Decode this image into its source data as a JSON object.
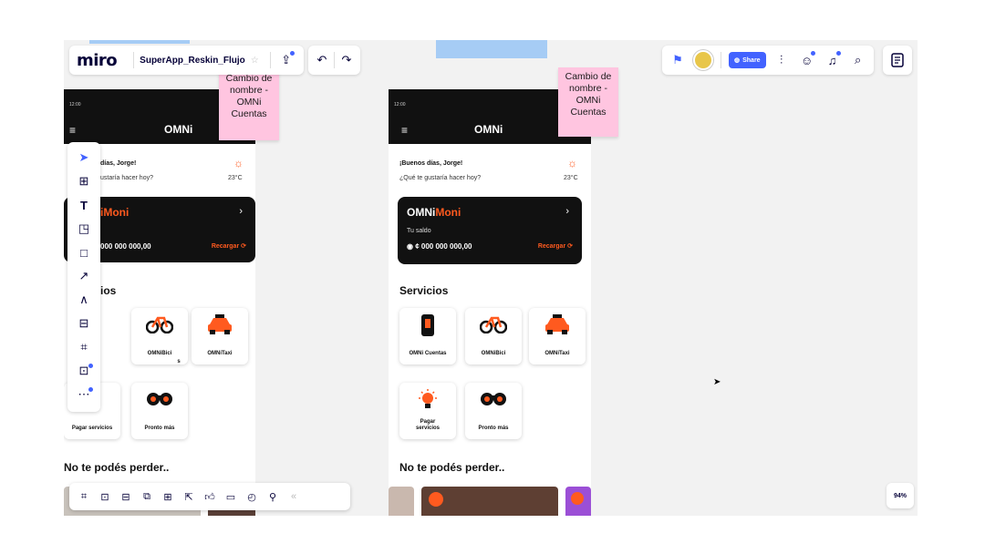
{
  "app": {
    "logo": "miro",
    "board_title": "SuperApp_Reskin_Flujo",
    "share_label": "Share",
    "zoom": "94%"
  },
  "stickies": [
    {
      "text": "Cambio de nombre - OMNi Cuentas"
    },
    {
      "text": "Cambio de nombre - OMNi Cuentas"
    }
  ],
  "phone": {
    "time": "12:00",
    "brand": "OMNi",
    "greeting_full": "¡Buenos días, Jorge!",
    "greeting_partial": "días, Jorge!",
    "question_full": "¿Qué te gustaría hacer hoy?",
    "question_partial": "ustaría hacer hoy?",
    "temp": "23°C",
    "wallet_brand": "OMNi",
    "wallet_moni": "Moni",
    "wallet_moni_partial": "iMoni",
    "wallet_label": "Tu saldo",
    "wallet_balance": "¢ 000 000 000,00",
    "wallet_balance_partial": "000 000 000,00",
    "recargar": "Recargar",
    "services_title": "Servicios",
    "services_partial": "ios",
    "services": [
      {
        "label": "OMNi Cuentas",
        "icon": "phone-icon"
      },
      {
        "label": "OMNiBici",
        "icon": "bike-icon"
      },
      {
        "label": "OMNiTaxi",
        "icon": "taxi-icon"
      },
      {
        "label": "Pagar servicios",
        "icon": "lightbulb-icon"
      },
      {
        "label": "Pronto más",
        "icon": "binoculars-icon"
      }
    ],
    "no_te_pierdas": "No te podés perder..",
    "partial_s": "S",
    "partial_icon_label": "s"
  },
  "colors": {
    "accent": "#ff5a1f",
    "miro_blue": "#4262ff",
    "sticky_pink": "#ffc5e0",
    "sticky_blue": "#a6ccf5"
  }
}
